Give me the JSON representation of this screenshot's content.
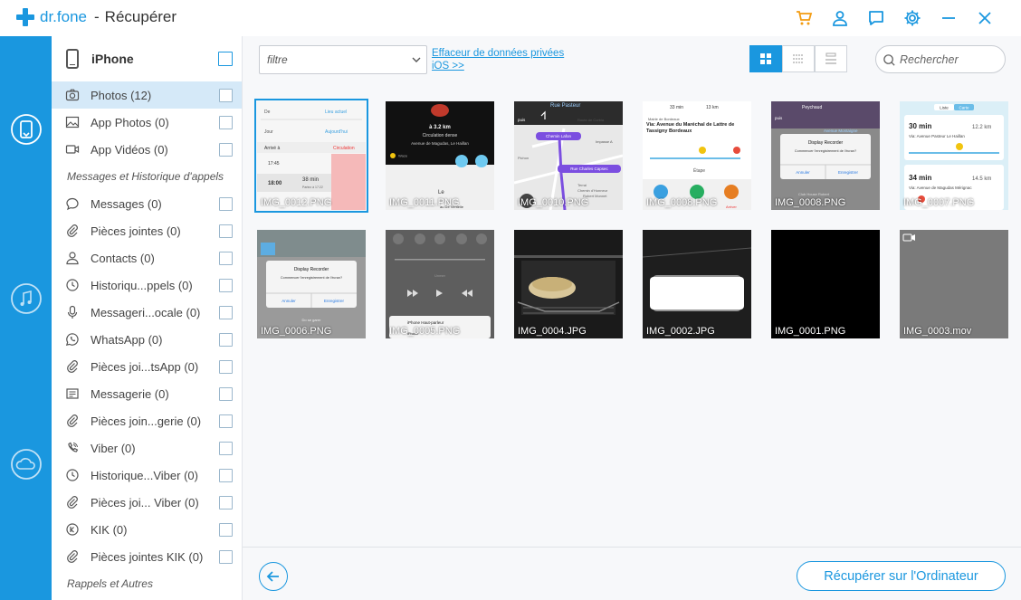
{
  "app": {
    "brand": "dr.fone",
    "separator": "-",
    "title": "Récupérer"
  },
  "colors": {
    "accent": "#1a97df",
    "cart": "#f39c12"
  },
  "title_icons": [
    "cart-icon",
    "user-icon",
    "feedback-icon",
    "settings-icon",
    "minimize-icon",
    "close-icon"
  ],
  "device": {
    "name": "iPhone"
  },
  "sidebar": {
    "media": [
      {
        "label": "Photos (12)",
        "icon": "camera-icon",
        "active": true
      },
      {
        "label": "App Photos (0)",
        "icon": "image-icon"
      },
      {
        "label": "App Vidéos (0)",
        "icon": "video-icon"
      }
    ],
    "section_messages": "Messages et Historique d'appels",
    "messages": [
      {
        "label": "Messages (0)",
        "icon": "message-icon"
      },
      {
        "label": "Pièces jointes (0)",
        "icon": "paperclip-icon"
      },
      {
        "label": "Contacts (0)",
        "icon": "contact-icon"
      },
      {
        "label": "Historiqu...ppels (0)",
        "icon": "clock-icon"
      },
      {
        "label": "Messageri...ocale (0)",
        "icon": "microphone-icon"
      },
      {
        "label": "WhatsApp (0)",
        "icon": "whatsapp-icon"
      },
      {
        "label": "Pièces joi...tsApp (0)",
        "icon": "paperclip-icon"
      },
      {
        "label": "Messagerie (0)",
        "icon": "messenger-icon"
      },
      {
        "label": "Pièces join...gerie  (0)",
        "icon": "paperclip-icon"
      },
      {
        "label": "Viber (0)",
        "icon": "viber-icon"
      },
      {
        "label": "Historique...Viber (0)",
        "icon": "clock-icon"
      },
      {
        "label": "Pièces joi... Viber (0)",
        "icon": "paperclip-icon"
      },
      {
        "label": "KIK (0)",
        "icon": "kik-icon"
      },
      {
        "label": "Pièces jointes KIK (0)",
        "icon": "paperclip-icon"
      }
    ],
    "section_other": "Rappels et Autres"
  },
  "toolbar": {
    "filter_placeholder": "filtre",
    "eraser_link": "Effaceur de données privées iOS >>",
    "search_placeholder": "Rechercher"
  },
  "thumbs": {
    "t1": {
      "name": "IMG_0012.PNG",
      "row1_label": "De",
      "row1_value": "Lieu actuel",
      "row2_label": "Jour",
      "row2_value": "Aujourd'hui",
      "col1": "Arrivé à",
      "col2": "Circulation",
      "time1": "17:45",
      "time2": "18:00",
      "dur": "38 min",
      "sub": "Partez à 17:22"
    },
    "t2": {
      "name": "IMG_0011.PNG",
      "dist": "à 3.2 km",
      "status": "Circulation dense",
      "street": "Avenue de Magudas, Le Haillan",
      "brand": "Waze",
      "place1": "Le",
      "place2": "au De Ventelle"
    },
    "t3": {
      "name": "IMG_0010.PNG",
      "street": "Rue Pasteur",
      "then": "puis",
      "road1": "Route de Corbia",
      "road2": "Impasse A",
      "pin1": "Chemin Lafon",
      "pin2": "Rue Charles Capsec",
      "place1": "Pichon",
      "place2": "Terrai",
      "place3": "Chemin d'Honneur",
      "place4": "Robert Monnet"
    },
    "t4": {
      "name": "IMG_0008.PNG",
      "eta": "33 min",
      "km": "13 km",
      "addr1": "Mairie de Bordeaux",
      "addr2": "Via: Avenue du Maréchal de Lattre de Tassigny Bordeaux",
      "stop": "Étape",
      "action": "Annuler",
      "btn3": "Arriver"
    },
    "t5": {
      "name": "IMG_0008.PNG",
      "street": "Peychaud",
      "then": "puis",
      "road": "Avenue Montaigne",
      "dialog_title": "Display Recorder",
      "dialog_body": "Commencer l'enregistrement de l'écran?",
      "cancel": "Annuler",
      "save": "Enregistrer",
      "house": "Club House Robert"
    },
    "t6": {
      "name": "IMG_0007.PNG",
      "tab1": "Liste",
      "tab2": "Carte",
      "eta1": "30 min",
      "km1": "12.2 km",
      "route1": "Via: Avenue Pasteur Le Haillan",
      "eta2": "34 min",
      "km2": "14.5 km",
      "route2": "Via: Avenue de Magudas Mérignac"
    },
    "t7": {
      "name": "IMG_0006.PNG",
      "dialog_title": "Display Recorder",
      "dialog_body": "Commencer l'enregistrement de l'écran?",
      "cancel": "Annuler",
      "save": "Enregistrer",
      "link": "Do se garer"
    },
    "t8": {
      "name": "IMG_0005.PNG",
      "speaker": "iPhone Haut-parleur",
      "phone": "iPhone",
      "label": "Unmer"
    },
    "t9": {
      "name": "IMG_0004.JPG"
    },
    "t10": {
      "name": "IMG_0002.JPG"
    },
    "t11": {
      "name": "IMG_0001.PNG"
    },
    "t12": {
      "name": "IMG_0003.mov"
    }
  },
  "footer": {
    "recover_label": "Récupérer sur l'Ordinateur"
  }
}
